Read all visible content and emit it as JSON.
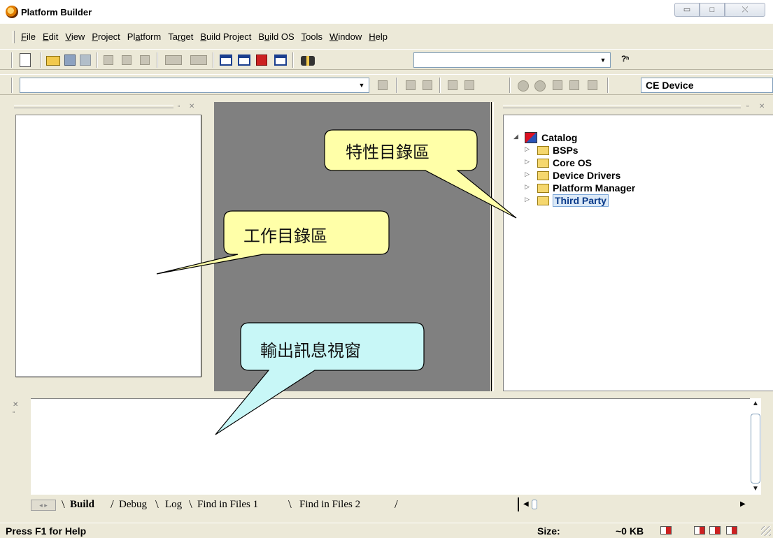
{
  "window": {
    "title": "Platform Builder",
    "controls": {
      "minimize": "▭",
      "maximize": "□",
      "close": "⤬"
    }
  },
  "menu": [
    {
      "label": "File",
      "accel": "F"
    },
    {
      "label": "Edit",
      "accel": "E"
    },
    {
      "label": "View",
      "accel": "V"
    },
    {
      "label": "Project",
      "accel": "P"
    },
    {
      "label": "Platform",
      "accel": "a"
    },
    {
      "label": "Target",
      "accel": "r"
    },
    {
      "label": "Build Project",
      "accel": "B"
    },
    {
      "label": "Build OS",
      "accel": "u"
    },
    {
      "label": "Tools",
      "accel": "T"
    },
    {
      "label": "Window",
      "accel": "W"
    },
    {
      "label": "Help",
      "accel": "H"
    }
  ],
  "toolbar": {
    "find_combo_value": "",
    "config_combo_value": "",
    "device": "CE Device"
  },
  "catalog": {
    "root": "Catalog",
    "items": [
      "BSPs",
      "Core OS",
      "Device Drivers",
      "Platform Manager",
      "Third Party"
    ],
    "selected": "Third Party"
  },
  "output": {
    "tabs": [
      "Build",
      "Debug",
      "Log",
      "Find in Files 1",
      "Find in Files 2"
    ],
    "active_tab": "Build"
  },
  "status": {
    "help": "Press F1 for Help",
    "size_label": "Size:",
    "size_value": "~0 KB"
  },
  "callouts": {
    "catalog_area": "特性目錄區",
    "workspace_area": "工作目錄區",
    "output_area": "輸出訊息視窗"
  },
  "colors": {
    "workspace_bg": "#808080",
    "chrome_bg": "#ece9d8",
    "callout_yellow": "#ffffa8",
    "callout_cyan": "#c8f7f7"
  }
}
